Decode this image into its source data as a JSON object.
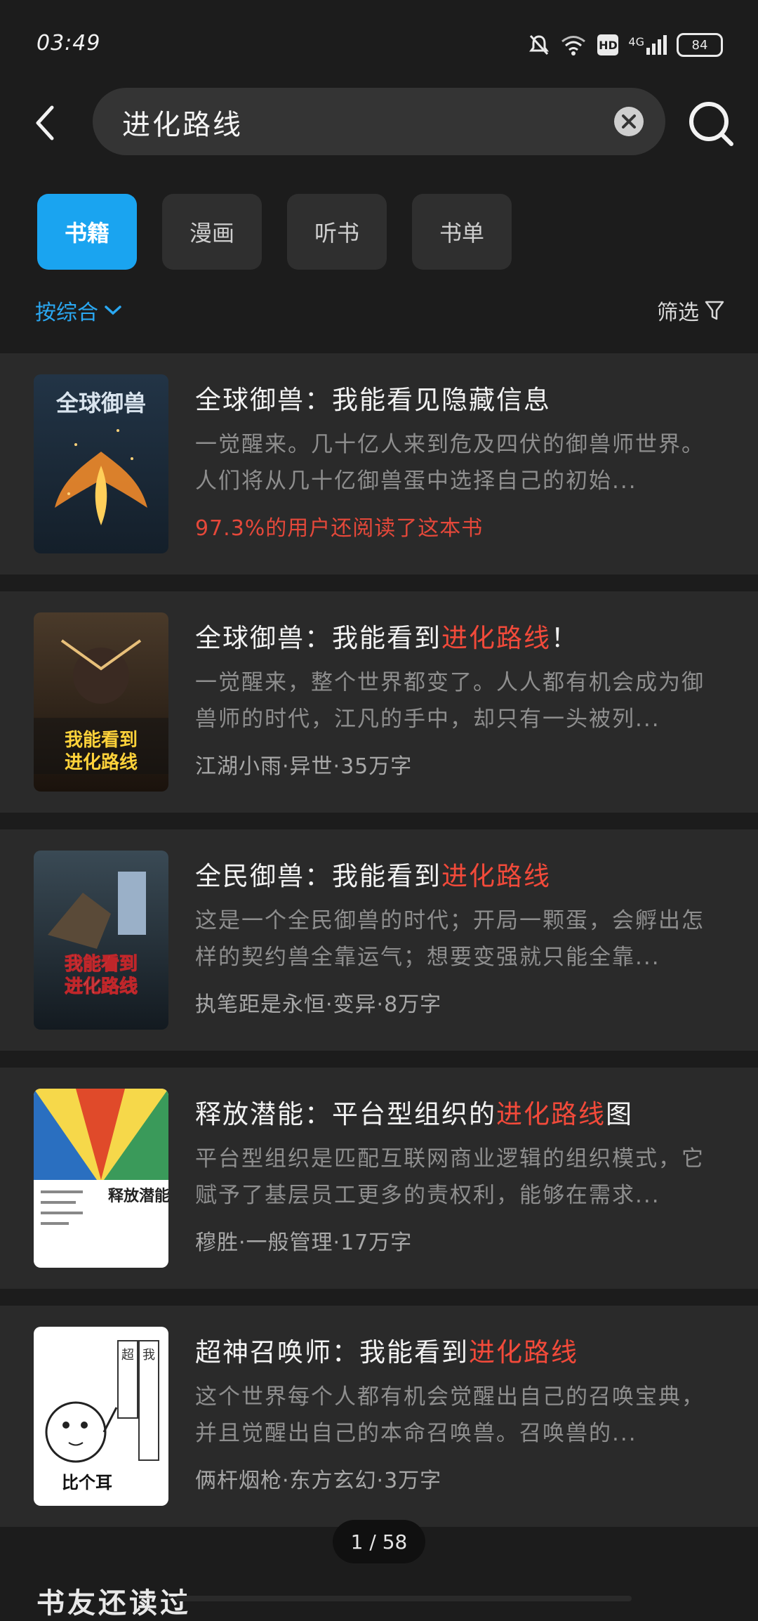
{
  "status_bar": {
    "time": "03:49",
    "network": "4G",
    "hd": "HD",
    "battery": "84"
  },
  "search": {
    "query": "进化路线"
  },
  "tabs": [
    {
      "label": "书籍",
      "active": true
    },
    {
      "label": "漫画",
      "active": false
    },
    {
      "label": "听书",
      "active": false
    },
    {
      "label": "书单",
      "active": false
    }
  ],
  "sort": {
    "label": "按综合",
    "filter_label": "筛选"
  },
  "highlight_color": "#f24a3a",
  "books": [
    {
      "title_pre": "全球御兽：我能看见隐藏信息",
      "title_hl": "",
      "title_post": "",
      "desc": "一觉醒来。几十亿人来到危及四伏的御兽师世界。人们将从几十亿御兽蛋中选择自己的初始...",
      "meta": "97.3%的用户还阅读了这本书",
      "meta_red": true,
      "cover": {
        "top_text": "全球御兽",
        "bottom_text": "",
        "bg": "#1b2a3a"
      }
    },
    {
      "title_pre": "全球御兽：我能看到",
      "title_hl": "进化路线",
      "title_post": "！",
      "desc": "一觉醒来，整个世界都变了。人人都有机会成为御兽师的时代，江凡的手中，却只有一头被列...",
      "meta": "江湖小雨·异世·35万字",
      "meta_red": false,
      "cover": {
        "top_text": "",
        "bottom_text": "我能看到进化路线",
        "bg": "#2b1a10"
      }
    },
    {
      "title_pre": "全民御兽：我能看到",
      "title_hl": "进化路线",
      "title_post": "",
      "desc": "这是一个全民御兽的时代；开局一颗蛋，会孵出怎样的契约兽全靠运气；想要变强就只能全靠...",
      "meta": "执笔距是永恒·变异·8万字",
      "meta_red": false,
      "cover": {
        "top_text": "",
        "bottom_text": "我能看到进化路线",
        "bg": "#23303a"
      }
    },
    {
      "title_pre": "释放潜能：平台型组织的",
      "title_hl": "进化路线",
      "title_post": "图",
      "desc": "平台型组织是匹配互联网商业逻辑的组织模式，它赋予了基层员工更多的责权利，能够在需求...",
      "meta": "穆胜·一般管理·17万字",
      "meta_red": false,
      "cover": {
        "top_text": "",
        "bottom_text": "释放潜能",
        "bg": "#f3e8b0"
      }
    },
    {
      "title_pre": "超神召唤师：我能看到",
      "title_hl": "进化路线",
      "title_post": "",
      "desc": "这个世界每个人都有机会觉醒出自己的召唤宝典，并且觉醒出自己的本命召唤兽。召唤兽的...",
      "meta": "俩杆烟枪·东方玄幻·3万字",
      "meta_red": false,
      "cover": {
        "top_text": "",
        "bottom_text": "",
        "bg": "#ffffff"
      }
    }
  ],
  "pagination": {
    "label": "1 / 58"
  },
  "next_section": {
    "title": "书友还读过"
  }
}
